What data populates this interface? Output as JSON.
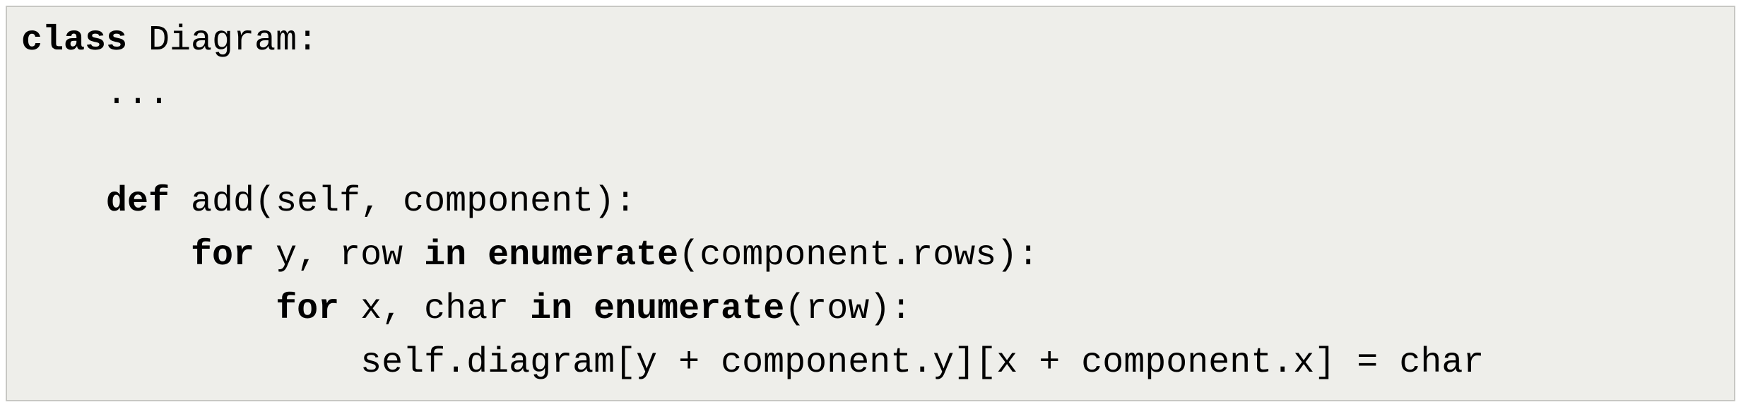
{
  "code": {
    "tokens": [
      {
        "type": "kw",
        "text": "class"
      },
      {
        "type": "plain",
        "text": " Diagram:\n"
      },
      {
        "type": "plain",
        "text": "    ...\n"
      },
      {
        "type": "plain",
        "text": "\n"
      },
      {
        "type": "plain",
        "text": "    "
      },
      {
        "type": "kw",
        "text": "def"
      },
      {
        "type": "plain",
        "text": " add(self, component):\n"
      },
      {
        "type": "plain",
        "text": "        "
      },
      {
        "type": "kw",
        "text": "for"
      },
      {
        "type": "plain",
        "text": " y, row "
      },
      {
        "type": "kw",
        "text": "in"
      },
      {
        "type": "plain",
        "text": " "
      },
      {
        "type": "kw",
        "text": "enumerate"
      },
      {
        "type": "plain",
        "text": "(component.rows):\n"
      },
      {
        "type": "plain",
        "text": "            "
      },
      {
        "type": "kw",
        "text": "for"
      },
      {
        "type": "plain",
        "text": " x, char "
      },
      {
        "type": "kw",
        "text": "in"
      },
      {
        "type": "plain",
        "text": " "
      },
      {
        "type": "kw",
        "text": "enumerate"
      },
      {
        "type": "plain",
        "text": "(row):\n"
      },
      {
        "type": "plain",
        "text": "                self.diagram[y + component.y][x + component.x] = char"
      }
    ]
  }
}
